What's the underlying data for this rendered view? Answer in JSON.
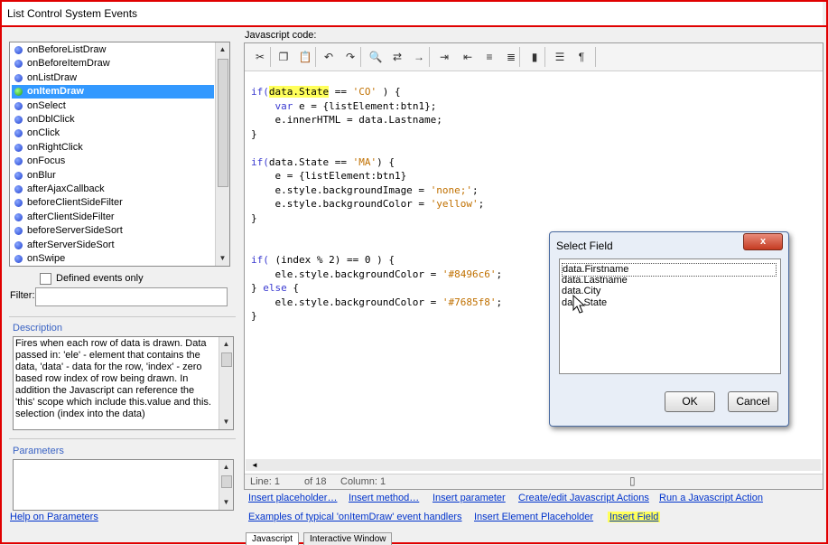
{
  "window": {
    "title": "List Control System Events"
  },
  "events": {
    "items": [
      {
        "label": "onBeforeListDraw",
        "status": "blue"
      },
      {
        "label": "onBeforeItemDraw",
        "status": "blue"
      },
      {
        "label": "onListDraw",
        "status": "blue"
      },
      {
        "label": "onItemDraw",
        "status": "green",
        "selected": true
      },
      {
        "label": "onSelect",
        "status": "blue"
      },
      {
        "label": "onDblClick",
        "status": "blue"
      },
      {
        "label": "onClick",
        "status": "blue"
      },
      {
        "label": "onRightClick",
        "status": "blue"
      },
      {
        "label": "onFocus",
        "status": "blue"
      },
      {
        "label": "onBlur",
        "status": "blue"
      },
      {
        "label": "afterAjaxCallback",
        "status": "blue"
      },
      {
        "label": "beforeClientSideFilter",
        "status": "blue"
      },
      {
        "label": "afterClientSideFilter",
        "status": "blue"
      },
      {
        "label": "beforeServerSideSort",
        "status": "blue"
      },
      {
        "label": "afterServerSideSort",
        "status": "blue"
      },
      {
        "label": "onSwipe",
        "status": "blue"
      }
    ],
    "defined_only_label": "Defined events only",
    "filter_label": "Filter:",
    "filter_value": ""
  },
  "description": {
    "title": "Description",
    "text": "Fires when each row of data is drawn. Data passed in: 'ele' - element that contains the data, 'data' - data for the row, 'index' - zero based row index of row being drawn.    In addition the Javascript can reference the 'this' scope which include this.value and this. selection (index into the data)"
  },
  "parameters": {
    "title": "Parameters",
    "help_link": "Help on Parameters"
  },
  "editor": {
    "label": "Javascript code:",
    "toolbar_icons": [
      "cut-icon",
      "copy-icon",
      "paste-icon",
      "undo-icon",
      "redo-icon",
      "find-icon",
      "replace-icon",
      "goto-icon",
      "indent-icon",
      "outdent-icon",
      "comment-icon",
      "uncomment-icon",
      "bookmark-icon",
      "list-icon",
      "format-icon"
    ],
    "code_lines": [
      [
        {
          "t": "if(",
          "c": "kw"
        },
        {
          "t": "data.State",
          "c": "hl"
        },
        {
          "t": " == "
        },
        {
          "t": "'CO'",
          "c": "st"
        },
        {
          "t": " ) {"
        }
      ],
      [
        {
          "t": "    "
        },
        {
          "t": "var",
          "c": "kw"
        },
        {
          "t": " e = {listElement:btn1};"
        }
      ],
      [
        {
          "t": "    e.innerHTML = data.Lastname;"
        }
      ],
      [
        {
          "t": "}"
        }
      ],
      [
        {
          "t": ""
        }
      ],
      [
        {
          "t": "if(",
          "c": "kw"
        },
        {
          "t": "data.State == "
        },
        {
          "t": "'MA'",
          "c": "st"
        },
        {
          "t": ") {"
        }
      ],
      [
        {
          "t": "    e = {listElement:btn1}"
        }
      ],
      [
        {
          "t": "    e.style.backgroundImage = "
        },
        {
          "t": "'none;'",
          "c": "st"
        },
        {
          "t": ";"
        }
      ],
      [
        {
          "t": "    e.style.backgroundColor = "
        },
        {
          "t": "'yellow'",
          "c": "st"
        },
        {
          "t": ";"
        }
      ],
      [
        {
          "t": "}"
        }
      ],
      [
        {
          "t": ""
        }
      ],
      [
        {
          "t": ""
        }
      ],
      [
        {
          "t": "if(",
          "c": "kw"
        },
        {
          "t": " (index % 2) == 0 ) {"
        }
      ],
      [
        {
          "t": "    ele.style.backgroundColor = "
        },
        {
          "t": "'#8496c6'",
          "c": "st"
        },
        {
          "t": ";"
        }
      ],
      [
        {
          "t": "} "
        },
        {
          "t": "else",
          "c": "kw"
        },
        {
          "t": " {"
        }
      ],
      [
        {
          "t": "    ele.style.backgroundColor = "
        },
        {
          "t": "'#7685f8'",
          "c": "st"
        },
        {
          "t": ";"
        }
      ],
      [
        {
          "t": "}"
        }
      ]
    ],
    "status": {
      "line": "Line: 1",
      "of": "of 18",
      "column": "Column: 1"
    }
  },
  "links": {
    "row1": [
      "Insert placeholder…",
      "Insert method…",
      "Insert parameter",
      "Create/edit Javascript Actions",
      "Run a Javascript Action"
    ],
    "row2": [
      "Examples of typical 'onItemDraw' event handlers",
      "Insert Element Placeholder",
      "Insert Field"
    ]
  },
  "tabs": [
    "Javascript",
    "Interactive Window"
  ],
  "dialog": {
    "title": "Select Field",
    "close": "x",
    "fields": [
      "data.Firstname",
      "data.Lastname",
      "data.City",
      "data.State"
    ],
    "selected_index": 0,
    "ok": "OK",
    "cancel": "Cancel"
  }
}
